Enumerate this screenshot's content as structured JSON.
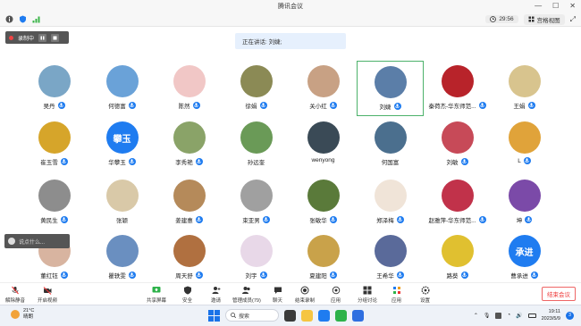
{
  "window": {
    "title": "腾讯会议"
  },
  "infobar": {
    "timer": "29:56",
    "view_label": "宫格视图"
  },
  "recording": {
    "label": "录制中"
  },
  "speaking": {
    "label": "正在讲话: 刘婕;"
  },
  "participants": [
    {
      "name": "吴丹",
      "color": "#7aa6c6",
      "mic": true
    },
    {
      "name": "何德富",
      "color": "#6aa2d8",
      "mic": true
    },
    {
      "name": "陈然",
      "color": "#f1c7c6",
      "mic": true
    },
    {
      "name": "徐娟",
      "color": "#8b8a55",
      "mic": true
    },
    {
      "name": "关小红",
      "color": "#c8a184",
      "mic": true
    },
    {
      "name": "刘婕",
      "color": "#5b7ea8",
      "mic": true,
      "active": true
    },
    {
      "name": "秦荷杰-华东师范...",
      "color": "#b8232a",
      "mic": true
    },
    {
      "name": "王娟",
      "color": "#d8c48e",
      "mic": true
    },
    {
      "name": "崔玉雪",
      "color": "#d6a52a",
      "mic": true
    },
    {
      "name": "华攀玉",
      "color": "#1f7cf0",
      "initials": "攀玉",
      "mic": true
    },
    {
      "name": "李秀艳",
      "color": "#8aa368",
      "mic": true
    },
    {
      "name": "孙远奎",
      "color": "#6a9a57",
      "mic": false
    },
    {
      "name": "wenyong",
      "color": "#3a4a56",
      "mic": false
    },
    {
      "name": "何国富",
      "color": "#4b6f8e",
      "mic": false
    },
    {
      "name": "刘敏",
      "color": "#c74a58",
      "mic": true
    },
    {
      "name": "L",
      "color": "#e0a33a",
      "mic": true
    },
    {
      "name": "黄民生",
      "color": "#8d8d8d",
      "mic": true
    },
    {
      "name": "张颖",
      "color": "#d9c9a8",
      "mic": false
    },
    {
      "name": "姜建惠",
      "color": "#b58a5a",
      "mic": true
    },
    {
      "name": "束亚男",
      "color": "#a0a0a0",
      "mic": true
    },
    {
      "name": "张敏华",
      "color": "#5a7a3a",
      "mic": true
    },
    {
      "name": "郑泽梅",
      "color": "#f0e4d8",
      "mic": true
    },
    {
      "name": "赵雅萍-华东师范...",
      "color": "#c1324a",
      "mic": true
    },
    {
      "name": "坤",
      "color": "#7b4aa8",
      "mic": true
    },
    {
      "name": "董红钰",
      "color": "#d8b4a0",
      "mic": true
    },
    {
      "name": "瞿轶雯",
      "color": "#6a8fc0",
      "mic": true
    },
    {
      "name": "周天舒",
      "color": "#b07040",
      "mic": true
    },
    {
      "name": "刘宇",
      "color": "#e8d8e8",
      "mic": true
    },
    {
      "name": "夏建阳",
      "color": "#c9a24a",
      "mic": true
    },
    {
      "name": "王希华",
      "color": "#5a6a9a",
      "mic": true
    },
    {
      "name": "路葵",
      "color": "#e0c030",
      "mic": true
    },
    {
      "name": "曹承进",
      "color": "#1f7cf0",
      "initials": "承进",
      "mic": true
    }
  ],
  "chat": {
    "placeholder": "说点什么..."
  },
  "toolbar": {
    "mute": "解除静音",
    "video": "开启视频",
    "share": "共享屏幕",
    "security": "安全",
    "invite": "邀请",
    "members": "管理成员(79)",
    "chat": "聊天",
    "recording": "结束录制",
    "apps": "应用",
    "breakout": "分组讨论",
    "app2": "应用",
    "settings": "设置",
    "end": "结束会议"
  },
  "taskbar": {
    "weather_temp": "21°C",
    "weather_desc": "晴朗",
    "search": "搜索",
    "time": "19:11",
    "date": "2023/5/9",
    "notifications": "3"
  },
  "colors": {
    "accent": "#1f7cf0",
    "active_border": "#4cb26a",
    "end": "#e33333"
  }
}
